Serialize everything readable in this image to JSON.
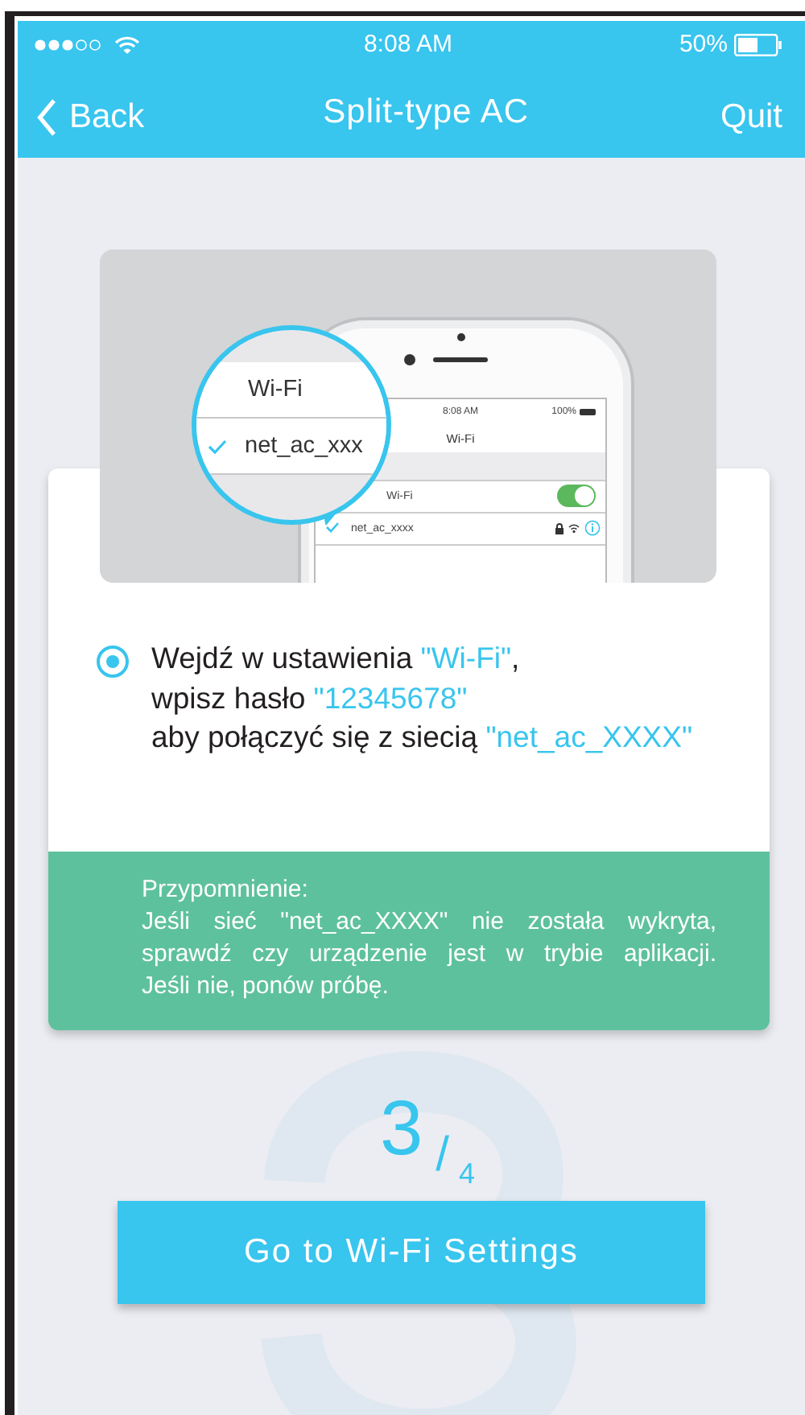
{
  "status_bar": {
    "time": "8:08 AM",
    "battery": "50%"
  },
  "nav": {
    "back": "Back",
    "title": "Split-type AC",
    "quit": "Quit"
  },
  "illustration": {
    "magnifier": {
      "rows": [
        {
          "label": "Wi-Fi",
          "checked": false
        },
        {
          "label": "net_ac_xxx",
          "checked": true
        }
      ]
    },
    "phone": {
      "time": "8:08 AM",
      "battery": "100%",
      "title": "Wi-Fi",
      "rows": [
        {
          "kind": "toggle",
          "label": "Wi-Fi",
          "on": true
        },
        {
          "kind": "network",
          "label": "net_ac_xxxx",
          "checked": true
        }
      ]
    }
  },
  "instruction": {
    "selected": true,
    "lines": [
      [
        {
          "text": "Wejdź w ustawienia ",
          "highlight": false
        },
        {
          "text": "\"Wi-Fi\"",
          "highlight": true
        },
        {
          "text": ",",
          "highlight": false
        }
      ],
      [
        {
          "text": "wpisz hasło ",
          "highlight": false
        },
        {
          "text": "\"12345678\"",
          "highlight": true
        }
      ],
      [
        {
          "text": "aby połączyć się z siecią ",
          "highlight": false
        },
        {
          "text": "\"net_ac_XXXX\"",
          "highlight": true
        }
      ]
    ]
  },
  "reminder": {
    "title": "Przypomnienie:",
    "lines": [
      "Jeśli sieć \"net_ac_XXXX\" nie została wykryta,",
      "sprawdź czy urządzenie jest w trybie aplikacji.",
      "Jeśli nie, ponów próbę."
    ]
  },
  "step": {
    "current": "3",
    "separator": "/",
    "total": "4"
  },
  "button": "Go to Wi-Fi Settings"
}
